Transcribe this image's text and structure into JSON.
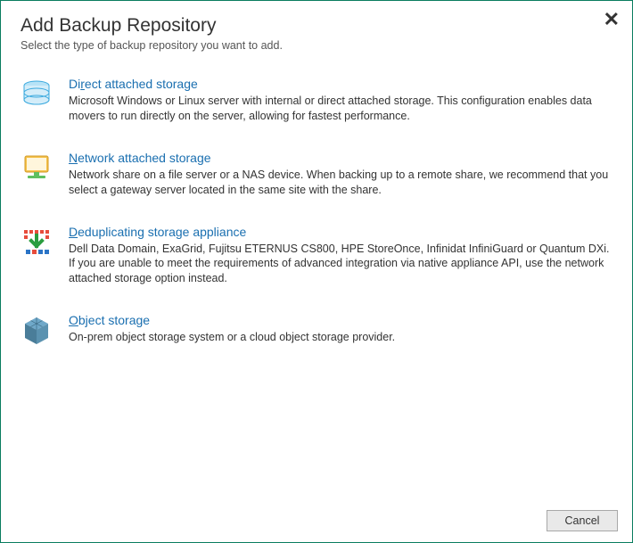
{
  "header": {
    "title": "Add Backup Repository",
    "subtitle": "Select the type of backup repository you want to add."
  },
  "options": [
    {
      "id": "direct-attached",
      "icon": "disk-stack-icon",
      "title_pre": "Di",
      "title_accel": "r",
      "title_post": "ect attached storage",
      "description": "Microsoft Windows or Linux server with internal or direct attached storage. This configuration enables data movers to run directly on the server, allowing for fastest performance."
    },
    {
      "id": "nas",
      "icon": "nas-icon",
      "title_pre": "",
      "title_accel": "N",
      "title_post": "etwork attached storage",
      "description": "Network share on a file server or a NAS device. When backing up to a remote share, we recommend that you select a gateway server located in the same site with the share."
    },
    {
      "id": "dedup",
      "icon": "dedup-icon",
      "title_pre": "",
      "title_accel": "D",
      "title_post": "eduplicating storage appliance",
      "description": "Dell Data Domain, ExaGrid, Fujitsu ETERNUS CS800, HPE StoreOnce, Infinidat InfiniGuard or Quantum DXi. If you are unable to meet the requirements of advanced integration via native appliance API, use the network attached storage option instead."
    },
    {
      "id": "object",
      "icon": "cube-icon",
      "title_pre": "",
      "title_accel": "O",
      "title_post": "bject storage",
      "description": "On-prem object storage system or a cloud object storage provider."
    }
  ],
  "footer": {
    "cancel_label": "Cancel"
  }
}
